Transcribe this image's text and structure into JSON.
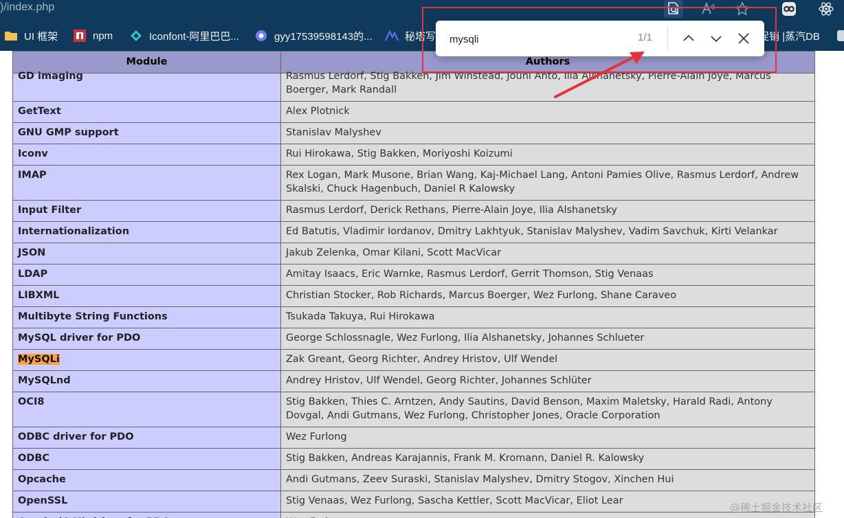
{
  "browser": {
    "url_fragment": ")/index.php"
  },
  "bookmarks": [
    {
      "label": "UI 框架",
      "icon": "folder-icon",
      "color": "#f2c14e"
    },
    {
      "label": "npm",
      "icon": "npm-icon",
      "color": "#cc3534"
    },
    {
      "label": "Iconfont-阿里巴巴...",
      "icon": "iconfont-icon",
      "color": "#31c3b6"
    },
    {
      "label": "gyy17539598143的...",
      "icon": "csdn-icon",
      "color": "#6d7bf5"
    },
    {
      "label": "秘塔写",
      "icon": "metaso-icon",
      "color": "#5b6ee1"
    },
    {
      "label": "促销 |蒸汽DB",
      "icon": "steamdb-icon",
      "color": "#cfd8e3"
    }
  ],
  "find": {
    "query": "mysqli",
    "count": "1/1"
  },
  "table": {
    "headers": [
      "Module",
      "Authors"
    ],
    "rows": [
      {
        "module": "GD imaging",
        "authors": "Rasmus Lerdorf, Stig Bakken, Jim Winstead, Jouni Ahto, Ilia Alshanetsky, Pierre-Alain Joye, Marcus Boerger, Mark Randall"
      },
      {
        "module": "GetText",
        "authors": "Alex Plotnick"
      },
      {
        "module": "GNU GMP support",
        "authors": "Stanislav Malyshev"
      },
      {
        "module": "Iconv",
        "authors": "Rui Hirokawa, Stig Bakken, Moriyoshi Koizumi"
      },
      {
        "module": "IMAP",
        "authors": "Rex Logan, Mark Musone, Brian Wang, Kaj-Michael Lang, Antoni Pamies Olive, Rasmus Lerdorf, Andrew Skalski, Chuck Hagenbuch, Daniel R Kalowsky"
      },
      {
        "module": "Input Filter",
        "authors": "Rasmus Lerdorf, Derick Rethans, Pierre-Alain Joye, Ilia Alshanetsky"
      },
      {
        "module": "Internationalization",
        "authors": "Ed Batutis, Vladimir Iordanov, Dmitry Lakhtyuk, Stanislav Malyshev, Vadim Savchuk, Kirti Velankar"
      },
      {
        "module": "JSON",
        "authors": "Jakub Zelenka, Omar Kilani, Scott MacVicar"
      },
      {
        "module": "LDAP",
        "authors": "Amitay Isaacs, Eric Warnke, Rasmus Lerdorf, Gerrit Thomson, Stig Venaas"
      },
      {
        "module": "LIBXML",
        "authors": "Christian Stocker, Rob Richards, Marcus Boerger, Wez Furlong, Shane Caraveo"
      },
      {
        "module": "Multibyte String Functions",
        "authors": "Tsukada Takuya, Rui Hirokawa"
      },
      {
        "module": "MySQL driver for PDO",
        "authors": "George Schlossnagle, Wez Furlong, Ilia Alshanetsky, Johannes Schlueter"
      },
      {
        "module": "MySQLi",
        "authors": "Zak Greant, Georg Richter, Andrey Hristov, Ulf Wendel",
        "highlight": true
      },
      {
        "module": "MySQLnd",
        "authors": "Andrey Hristov, Ulf Wendel, Georg Richter, Johannes Schlüter"
      },
      {
        "module": "OCI8",
        "authors": "Stig Bakken, Thies C. Arntzen, Andy Sautins, David Benson, Maxim Maletsky, Harald Radi, Antony Dovgal, Andi Gutmans, Wez Furlong, Christopher Jones, Oracle Corporation"
      },
      {
        "module": "ODBC driver for PDO",
        "authors": "Wez Furlong"
      },
      {
        "module": "ODBC",
        "authors": "Stig Bakken, Andreas Karajannis, Frank M. Kromann, Daniel R. Kalowsky"
      },
      {
        "module": "Opcache",
        "authors": "Andi Gutmans, Zeev Suraski, Stanislav Malyshev, Dmitry Stogov, Xinchen Hui"
      },
      {
        "module": "OpenSSL",
        "authors": "Stig Venaas, Wez Furlong, Sascha Kettler, Scott MacVicar, Eliot Lear"
      },
      {
        "module": "Oracle (OCI) driver for PDO",
        "authors": "Wez Furlong"
      }
    ]
  },
  "annotation": {
    "color": "#e8323a"
  },
  "watermark": "@稀土掘金技术社区"
}
